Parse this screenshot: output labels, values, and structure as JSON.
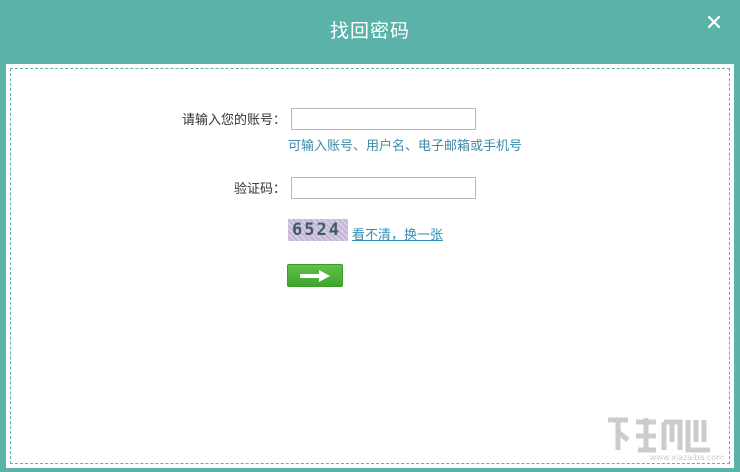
{
  "window": {
    "title": "找回密码"
  },
  "form": {
    "account_label": "请输入您的账号：",
    "account_value": "",
    "account_hint": "可输入账号、用户名、电子邮箱或手机号",
    "captcha_label": "验证码：",
    "captcha_value": "",
    "captcha_image_text": "6524",
    "refresh_link": "看不清，换一张"
  },
  "watermark": {
    "url": "www.xiazaiba.com"
  },
  "colors": {
    "frame": "#5bb2a8",
    "hint": "#3d8aa8",
    "link": "#2f8fb5",
    "button": "#4cb43a"
  },
  "icons": {
    "close": "close-icon",
    "submit": "arrow-right-icon"
  }
}
